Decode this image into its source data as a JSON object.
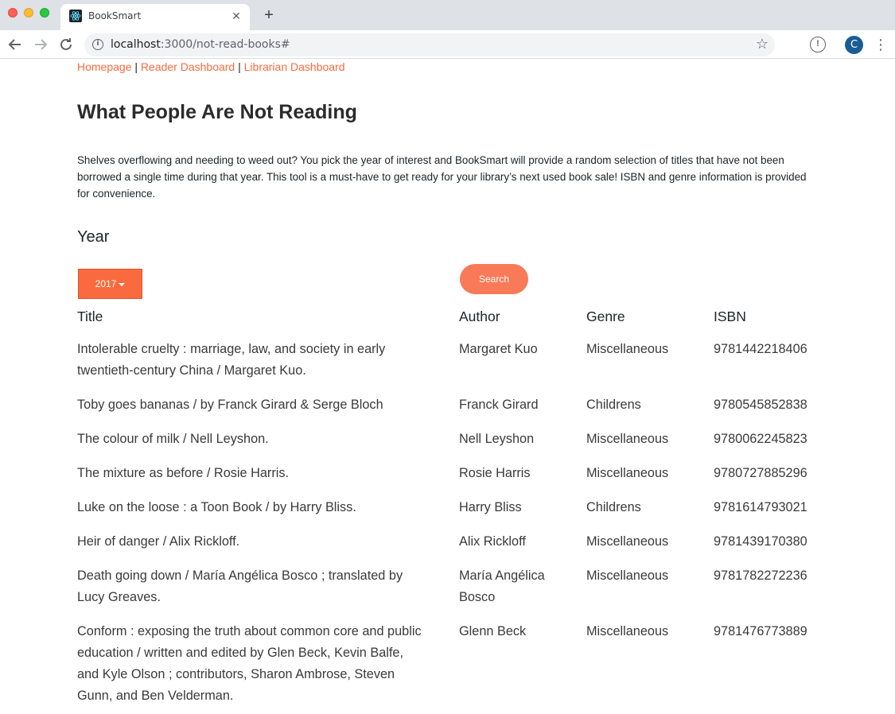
{
  "browser": {
    "tab_title": "BookSmart",
    "url_host": "localhost",
    "url_path": ":3000/not-read-books#",
    "avatar_letter": "C"
  },
  "nav": {
    "homepage": "Homepage",
    "reader_dashboard": "Reader Dashboard",
    "librarian_dashboard": "Librarian Dashboard",
    "separator": " | "
  },
  "heading": "What People Are Not Reading",
  "intro": "Shelves overflowing and needing to weed out? You pick the year of interest and BookSmart will provide a random selection of titles that have not been borrowed a single time during that year. This tool is a must-have to get ready for your library’s next used book sale! ISBN and genre information is provided for convenience.",
  "year_label": "Year",
  "year_selected": "2017",
  "search_label": "Search",
  "table": {
    "headers": {
      "title": "Title",
      "author": "Author",
      "genre": "Genre",
      "isbn": "ISBN"
    },
    "rows": [
      {
        "title": "Intolerable cruelty : marriage, law, and society in early twentieth-century China / Margaret Kuo.",
        "author": "Margaret Kuo",
        "genre": "Miscellaneous",
        "isbn": "9781442218406"
      },
      {
        "title": "Toby goes bananas / by Franck Girard & Serge Bloch",
        "author": "Franck Girard",
        "genre": "Childrens",
        "isbn": "9780545852838"
      },
      {
        "title": "The colour of milk / Nell Leyshon.",
        "author": "Nell Leyshon",
        "genre": "Miscellaneous",
        "isbn": "9780062245823"
      },
      {
        "title": "The mixture as before / Rosie Harris.",
        "author": "Rosie Harris",
        "genre": "Miscellaneous",
        "isbn": "9780727885296"
      },
      {
        "title": "Luke on the loose : a Toon Book / by Harry Bliss.",
        "author": "Harry Bliss",
        "genre": "Childrens",
        "isbn": "9781614793021"
      },
      {
        "title": "Heir of danger / Alix Rickloff.",
        "author": "Alix Rickloff",
        "genre": "Miscellaneous",
        "isbn": "9781439170380"
      },
      {
        "title": "Death going down / María Angélica Bosco ; translated by Lucy Greaves.",
        "author": "María Angélica Bosco",
        "genre": "Miscellaneous",
        "isbn": "9781782272236"
      },
      {
        "title": "Conform : exposing the truth about common core and public education / written and edited by Glen Beck, Kevin Balfe, and Kyle Olson ; contributors, Sharon Ambrose, Steven Gunn, and Ben Velderman.",
        "author": "Glenn Beck",
        "genre": "Miscellaneous",
        "isbn": "9781476773889"
      }
    ]
  },
  "colors": {
    "accent": "#f96b3e",
    "search_button": "#f97a58"
  }
}
